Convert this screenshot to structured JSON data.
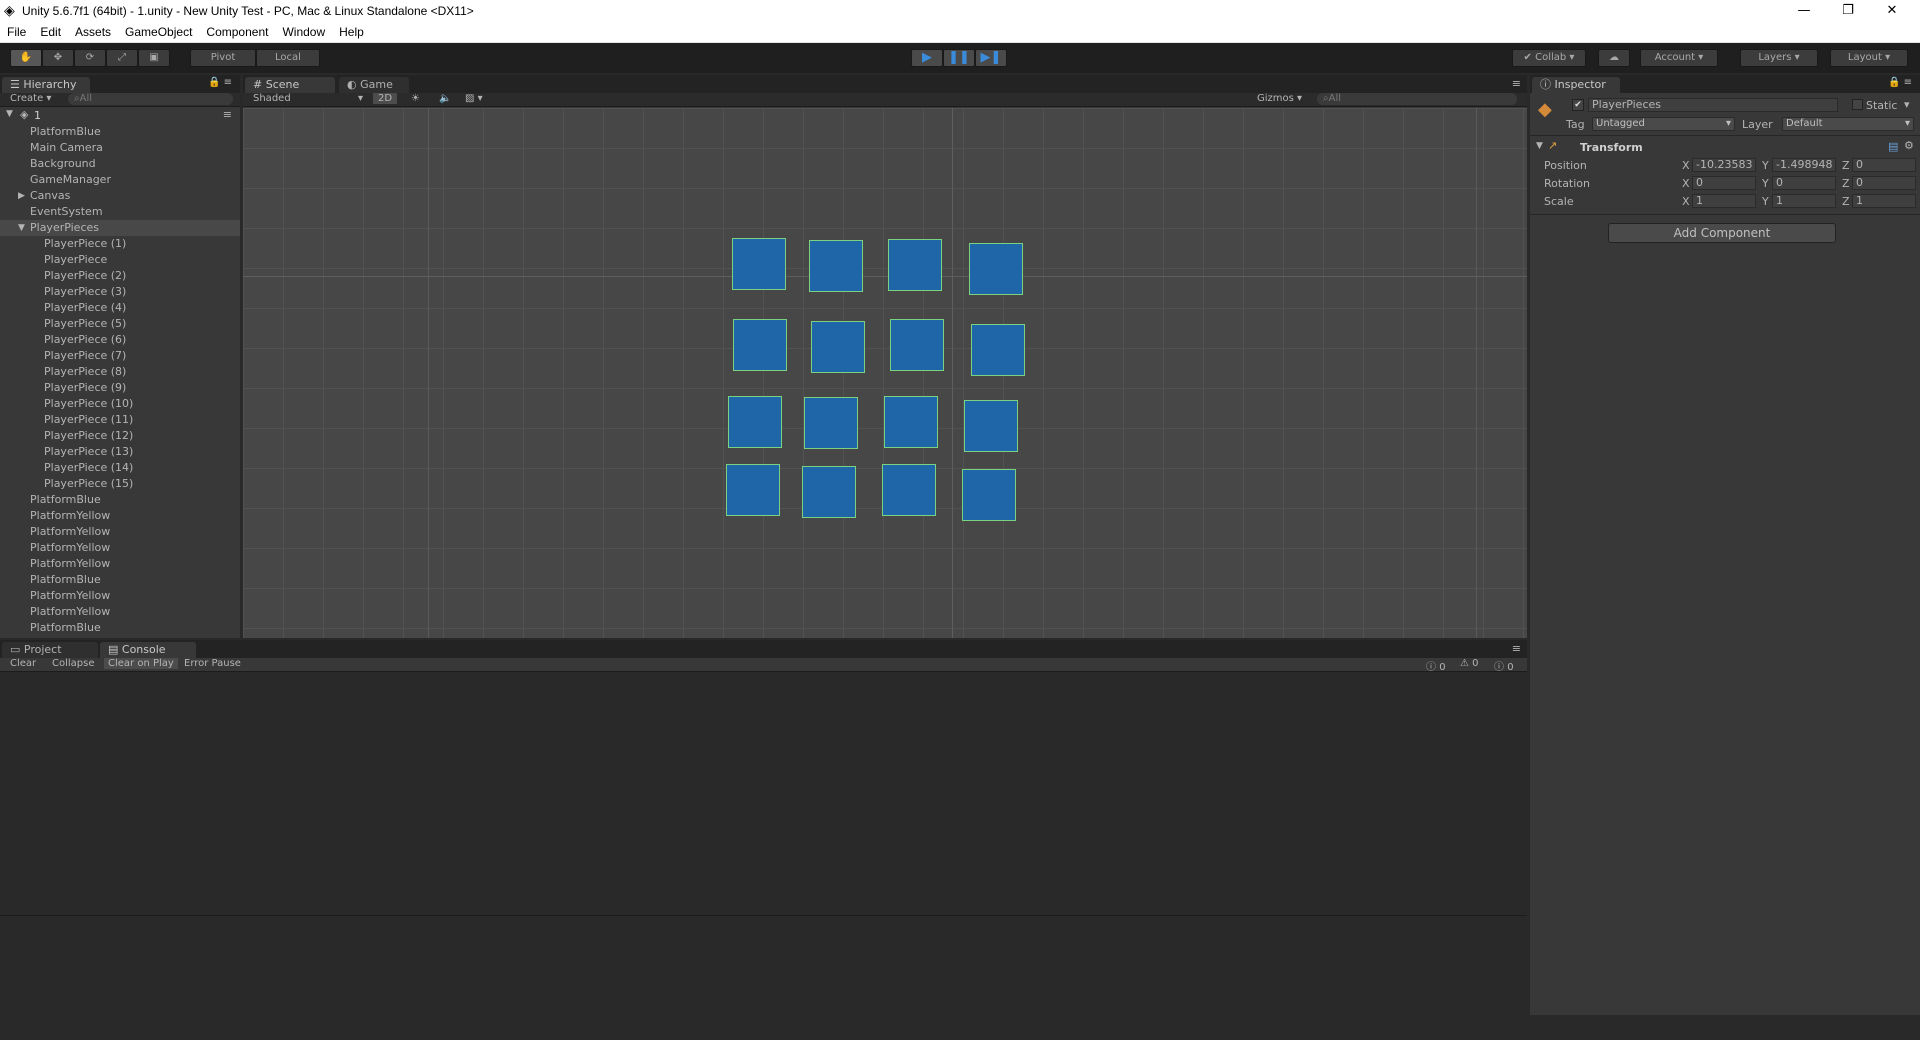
{
  "window": {
    "title": "Unity 5.6.7f1 (64bit) - 1.unity - New Unity Test - PC, Mac & Linux Standalone <DX11>",
    "minimize": "—",
    "restore": "❐",
    "close": "✕"
  },
  "menu": [
    "File",
    "Edit",
    "Assets",
    "GameObject",
    "Component",
    "Window",
    "Help"
  ],
  "toolbar": {
    "pivot": "Pivot",
    "local": "Local",
    "collab": "Collab",
    "account": "Account",
    "layers": "Layers",
    "layout": "Layout"
  },
  "hierarchy": {
    "tab": "Hierarchy",
    "create": "Create",
    "search_placeholder": "All",
    "scene_name": "1",
    "items": [
      {
        "label": "PlatformBlue",
        "indent": 1
      },
      {
        "label": "Main Camera",
        "indent": 1
      },
      {
        "label": "Background",
        "indent": 1
      },
      {
        "label": "GameManager",
        "indent": 1
      },
      {
        "label": "Canvas",
        "indent": 1,
        "arrow": "collapsed"
      },
      {
        "label": "EventSystem",
        "indent": 1
      },
      {
        "label": "PlayerPieces",
        "indent": 1,
        "arrow": "expanded"
      },
      {
        "label": "PlayerPiece (1)",
        "indent": 2
      },
      {
        "label": "PlayerPiece",
        "indent": 2
      },
      {
        "label": "PlayerPiece (2)",
        "indent": 2
      },
      {
        "label": "PlayerPiece (3)",
        "indent": 2
      },
      {
        "label": "PlayerPiece (4)",
        "indent": 2
      },
      {
        "label": "PlayerPiece (5)",
        "indent": 2
      },
      {
        "label": "PlayerPiece (6)",
        "indent": 2
      },
      {
        "label": "PlayerPiece (7)",
        "indent": 2
      },
      {
        "label": "PlayerPiece (8)",
        "indent": 2
      },
      {
        "label": "PlayerPiece (9)",
        "indent": 2
      },
      {
        "label": "PlayerPiece (10)",
        "indent": 2
      },
      {
        "label": "PlayerPiece (11)",
        "indent": 2
      },
      {
        "label": "PlayerPiece (12)",
        "indent": 2
      },
      {
        "label": "PlayerPiece (13)",
        "indent": 2
      },
      {
        "label": "PlayerPiece (14)",
        "indent": 2
      },
      {
        "label": "PlayerPiece (15)",
        "indent": 2
      },
      {
        "label": "PlatformBlue",
        "indent": 1
      },
      {
        "label": "PlatformYellow",
        "indent": 1
      },
      {
        "label": "PlatformYellow",
        "indent": 1
      },
      {
        "label": "PlatformYellow",
        "indent": 1
      },
      {
        "label": "PlatformYellow",
        "indent": 1
      },
      {
        "label": "PlatformBlue",
        "indent": 1
      },
      {
        "label": "PlatformYellow",
        "indent": 1
      },
      {
        "label": "PlatformYellow",
        "indent": 1
      },
      {
        "label": "PlatformBlue",
        "indent": 1
      }
    ]
  },
  "scene": {
    "tab_scene": "Scene",
    "tab_game": "Game",
    "shading": "Shaded",
    "mode_2d": "2D",
    "gizmos": "Gizmos",
    "search_placeholder": "All"
  },
  "console": {
    "tab_project": "Project",
    "tab_console": "Console",
    "clear": "Clear",
    "collapse": "Collapse",
    "clear_on_play": "Clear on Play",
    "error_pause": "Error Pause",
    "info_count": "0",
    "warning_count": "0",
    "error_count": "0"
  },
  "inspector": {
    "tab": "Inspector",
    "object_name": "PlayerPieces",
    "static_label": "Static",
    "tag_label": "Tag",
    "tag_value": "Untagged",
    "layer_label": "Layer",
    "layer_value": "Default",
    "transform_title": "Transform",
    "position_label": "Position",
    "rotation_label": "Rotation",
    "scale_label": "Scale",
    "x": "X",
    "y": "Y",
    "z": "Z",
    "position": {
      "x": "-10.23583",
      "y": "-1.498948",
      "z": "0"
    },
    "rotation": {
      "x": "0",
      "y": "0",
      "z": "0"
    },
    "scale": {
      "x": "1",
      "y": "1",
      "z": "1"
    },
    "add_component": "Add Component"
  },
  "colors": {
    "piece_fill": "#1e66a8",
    "piece_outline": "#7ad17f",
    "play_accent": "#3a8bd9"
  }
}
